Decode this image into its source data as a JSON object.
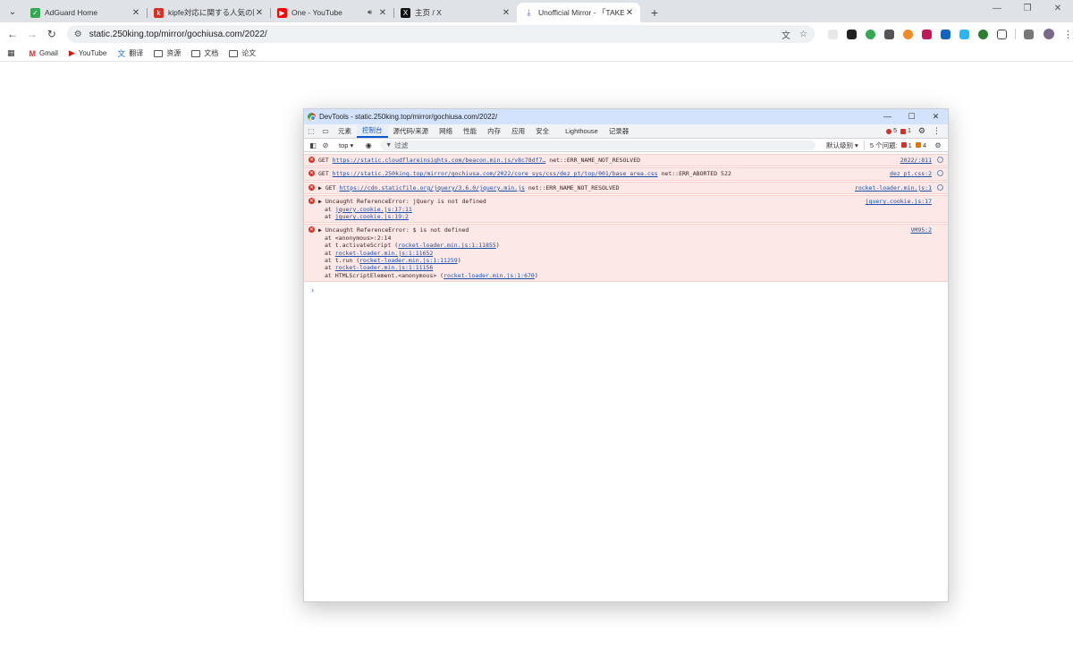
{
  "browser": {
    "tabs": [
      {
        "title": "AdGuard Home",
        "favicon": "adguard-shield-icon",
        "color": "#34a853"
      },
      {
        "title": "kipfe対応に関する人気の同人誌",
        "favicon": "kipfe-icon",
        "color": "#d93025"
      },
      {
        "title": "One - YouTube",
        "favicon": "youtube-icon",
        "color": "#ff0000"
      },
      {
        "title": "主页 / X",
        "favicon": "x-icon",
        "color": "#111111"
      },
      {
        "title": "Unofficial Mirror - 「TAKE OUT」",
        "favicon": "download-icon",
        "color": "#4a7bd0"
      }
    ],
    "address": "static.250king.top/mirror/gochiusa.com/2022/",
    "bookmarks": [
      {
        "label": "Gmail"
      },
      {
        "label": "YouTube"
      },
      {
        "label": "翻译"
      },
      {
        "label": "资源"
      },
      {
        "label": "文档"
      },
      {
        "label": "论文"
      }
    ]
  },
  "devtools": {
    "title": "DevTools - static.250king.top/mirror/gochiusa.com/2022/",
    "tabs": [
      "元素",
      "控制台",
      "源代码/来源",
      "网络",
      "性能",
      "内存",
      "应用",
      "安全",
      "Lighthouse",
      "记录器"
    ],
    "active_tab": "控制台",
    "error_count": "5",
    "warn_count": "1",
    "filter": {
      "context": "top ▾",
      "placeholder": "过滤",
      "levels": "默认级别 ▾",
      "issues_label": "5 个问题:",
      "issues_errors": "1",
      "issues_warnings": "4"
    },
    "messages": [
      {
        "prefix": "GET ",
        "link": "https://static.cloudflareinsights.com/beacon.min.js/v8c78df7…",
        "suffix": " net::ERR_NAME_NOT_RESOLVED",
        "source": "2022/:811"
      },
      {
        "prefix": "GET ",
        "link": "https://static.250king.top/mirror/gochiusa.com/2022/core_sys/css/dez_pt/top/001/base_area.css",
        "suffix": " net::ERR_ABORTED 522",
        "source": "dez_pt.css:2"
      },
      {
        "prefix": "▶ GET ",
        "link": "https://cdn.staticfile.org/jquery/3.6.0/jquery.min.js",
        "suffix": " net::ERR_NAME_NOT_RESOLVED",
        "source": "rocket-loader.min.js:1"
      },
      {
        "prefix": "▶ Uncaught ReferenceError: jQuery is not defined",
        "source": "jquery.cookie.js:17",
        "stack": [
          {
            "pre": "at ",
            "link": "jquery.cookie.js:17:11",
            "post": ""
          },
          {
            "pre": "at ",
            "link": "jquery.cookie.js:19:2",
            "post": ""
          }
        ]
      },
      {
        "prefix": "▶ Uncaught ReferenceError: $ is not defined",
        "source": "VM95:2",
        "stack": [
          {
            "pre": "at <anonymous>:2:14",
            "link": "",
            "post": ""
          },
          {
            "pre": "at t.activateScript (",
            "link": "rocket-loader.min.js:1:11855",
            "post": ")"
          },
          {
            "pre": "at ",
            "link": "rocket-loader.min.js:1:11652",
            "post": ""
          },
          {
            "pre": "at t.run (",
            "link": "rocket-loader.min.js:1:11259",
            "post": ")"
          },
          {
            "pre": "at ",
            "link": "rocket-loader.min.js:1:11156",
            "post": ""
          },
          {
            "pre": "at HTMLScriptElement.<anonymous> (",
            "link": "rocket-loader.min.js:1:670",
            "post": ")"
          }
        ]
      }
    ],
    "prompt": "›"
  }
}
